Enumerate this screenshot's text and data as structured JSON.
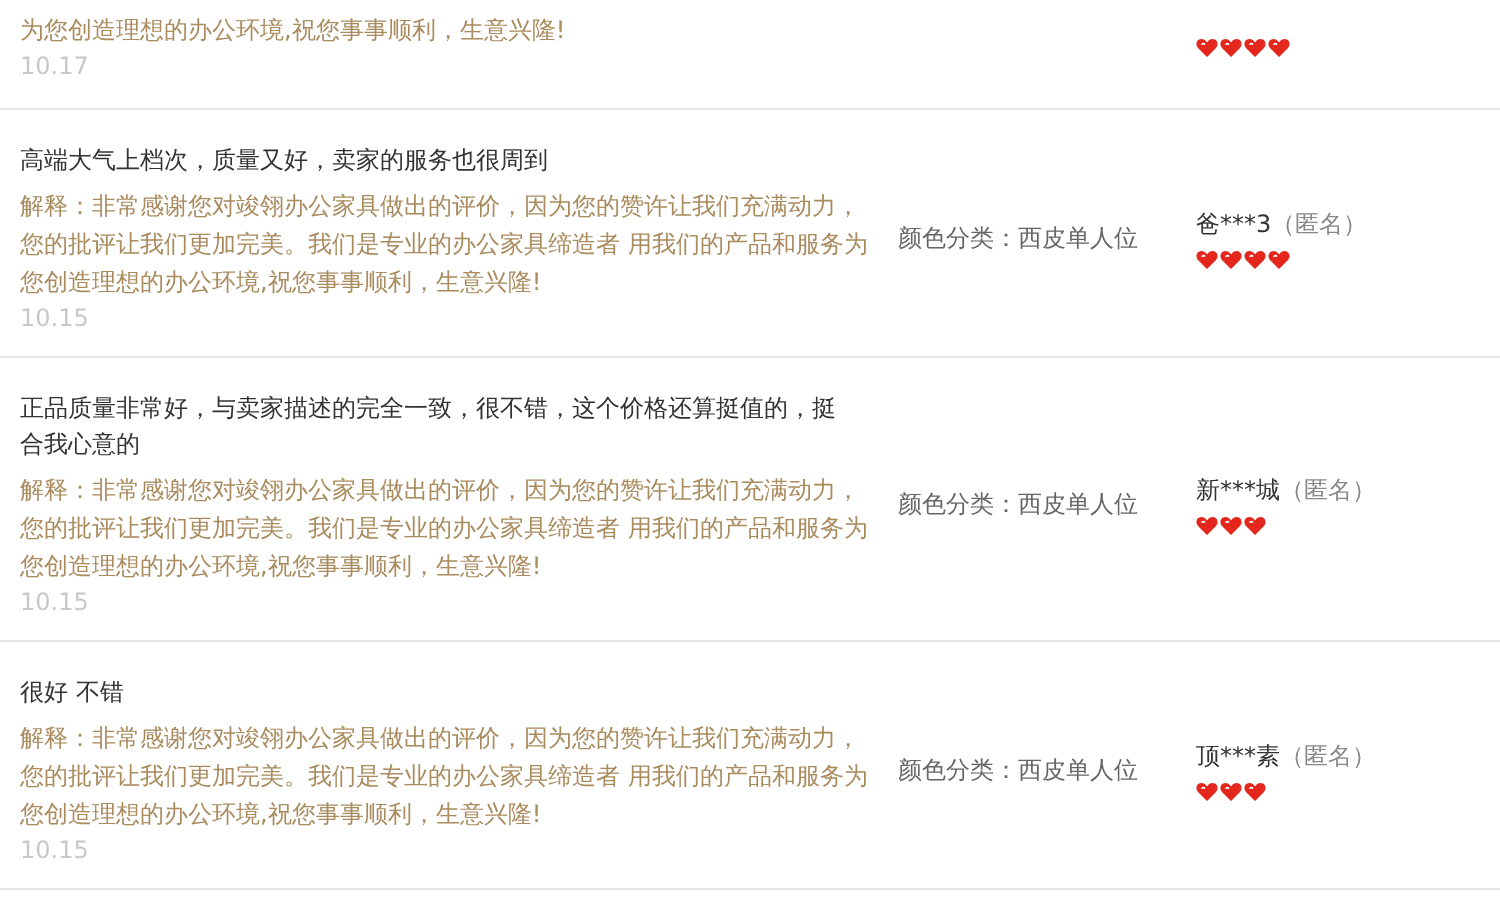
{
  "reviews": [
    {
      "reply": "为您创造理想的办公环境,祝您事事顺利，生意兴隆!",
      "date": "10.17",
      "stars": 4
    },
    {
      "comment": "高端大气上档次，质量又好，卖家的服务也很周到",
      "reply": "解释：非常感谢您对竣翎办公家具做出的评价，因为您的赞许让我们充满动力，您的批评让我们更加完美。我们是专业的办公家具缔造者 用我们的产品和服务为您创造理想的办公环境,祝您事事顺利，生意兴隆!",
      "date": "10.15",
      "variant": "颜色分类：西皮单人位",
      "user": "爸***3",
      "tag": "（匿名）",
      "stars": 4
    },
    {
      "comment": "正品质量非常好，与卖家描述的完全一致，很不错，这个价格还算挺值的，挺合我心意的",
      "reply": "解释：非常感谢您对竣翎办公家具做出的评价，因为您的赞许让我们充满动力，您的批评让我们更加完美。我们是专业的办公家具缔造者 用我们的产品和服务为您创造理想的办公环境,祝您事事顺利，生意兴隆!",
      "date": "10.15",
      "variant": "颜色分类：西皮单人位",
      "user": "新***城",
      "tag": "（匿名）",
      "stars": 3
    },
    {
      "comment": "很好 不错",
      "reply": "解释：非常感谢您对竣翎办公家具做出的评价，因为您的赞许让我们充满动力，您的批评让我们更加完美。我们是专业的办公家具缔造者 用我们的产品和服务为您创造理想的办公环境,祝您事事顺利，生意兴隆!",
      "date": "10.15",
      "variant": "颜色分类：西皮单人位",
      "user": "顶***素",
      "tag": "（匿名）",
      "stars": 3
    }
  ]
}
